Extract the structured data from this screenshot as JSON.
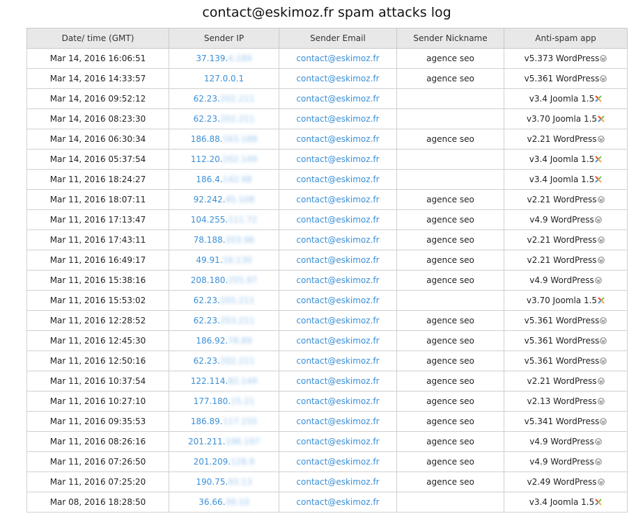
{
  "title": "contact@eskimoz.fr spam attacks log",
  "columns": [
    "Date/ time (GMT)",
    "Sender IP",
    "Sender Email",
    "Sender Nickname",
    "Anti-spam app"
  ],
  "rows": [
    {
      "date": "Mar 14, 2016 16:06:51",
      "ip": "37.139.",
      "ip_hidden": "4.189",
      "email": "contact@eskimoz.fr",
      "nick": "agence seo",
      "app": "v5.373 WordPress",
      "icon": "wordpress-icon"
    },
    {
      "date": "Mar 14, 2016 14:33:57",
      "ip": "127.0.0.1",
      "ip_hidden": "",
      "email": "contact@eskimoz.fr",
      "nick": "agence seo",
      "app": "v5.361 WordPress",
      "icon": "wordpress-icon"
    },
    {
      "date": "Mar 14, 2016 09:52:12",
      "ip": "62.23.",
      "ip_hidden": "202.211",
      "email": "contact@eskimoz.fr",
      "nick": "",
      "app": "v3.4 Joomla 1.5",
      "icon": "joomla-icon"
    },
    {
      "date": "Mar 14, 2016 08:23:30",
      "ip": "62.23.",
      "ip_hidden": "202.211",
      "email": "contact@eskimoz.fr",
      "nick": "",
      "app": "v3.70 Joomla 1.5",
      "icon": "joomla-icon"
    },
    {
      "date": "Mar 14, 2016 06:30:34",
      "ip": "186.88.",
      "ip_hidden": "163.188",
      "email": "contact@eskimoz.fr",
      "nick": "agence seo",
      "app": "v2.21 WordPress",
      "icon": "wordpress-icon"
    },
    {
      "date": "Mar 14, 2016 05:37:54",
      "ip": "112.20.",
      "ip_hidden": "202.149",
      "email": "contact@eskimoz.fr",
      "nick": "",
      "app": "v3.4 Joomla 1.5",
      "icon": "joomla-icon"
    },
    {
      "date": "Mar 11, 2016 18:24:27",
      "ip": "186.4.",
      "ip_hidden": "142.98",
      "email": "contact@eskimoz.fr",
      "nick": "",
      "app": "v3.4 Joomla 1.5",
      "icon": "joomla-icon"
    },
    {
      "date": "Mar 11, 2016 18:07:11",
      "ip": "92.242.",
      "ip_hidden": "45.108",
      "email": "contact@eskimoz.fr",
      "nick": "agence seo",
      "app": "v2.21 WordPress",
      "icon": "wordpress-icon"
    },
    {
      "date": "Mar 11, 2016 17:13:47",
      "ip": "104.255.",
      "ip_hidden": "111.72",
      "email": "contact@eskimoz.fr",
      "nick": "agence seo",
      "app": "v4.9 WordPress",
      "icon": "wordpress-icon"
    },
    {
      "date": "Mar 11, 2016 17:43:11",
      "ip": "78.188.",
      "ip_hidden": "203.96",
      "email": "contact@eskimoz.fr",
      "nick": "agence seo",
      "app": "v2.21 WordPress",
      "icon": "wordpress-icon"
    },
    {
      "date": "Mar 11, 2016 16:49:17",
      "ip": "49.91.",
      "ip_hidden": "16.130",
      "email": "contact@eskimoz.fr",
      "nick": "agence seo",
      "app": "v2.21 WordPress",
      "icon": "wordpress-icon"
    },
    {
      "date": "Mar 11, 2016 15:38:16",
      "ip": "208.180.",
      "ip_hidden": "255.97",
      "email": "contact@eskimoz.fr",
      "nick": "agence seo",
      "app": "v4.9 WordPress",
      "icon": "wordpress-icon"
    },
    {
      "date": "Mar 11, 2016 15:53:02",
      "ip": "62.23.",
      "ip_hidden": "205.211",
      "email": "contact@eskimoz.fr",
      "nick": "",
      "app": "v3.70 Joomla 1.5",
      "icon": "joomla-icon"
    },
    {
      "date": "Mar 11, 2016 12:28:52",
      "ip": "62.23.",
      "ip_hidden": "203.211",
      "email": "contact@eskimoz.fr",
      "nick": "agence seo",
      "app": "v5.361 WordPress",
      "icon": "wordpress-icon"
    },
    {
      "date": "Mar 11, 2016 12:45:30",
      "ip": "186.92.",
      "ip_hidden": "78.89",
      "email": "contact@eskimoz.fr",
      "nick": "agence seo",
      "app": "v5.361 WordPress",
      "icon": "wordpress-icon"
    },
    {
      "date": "Mar 11, 2016 12:50:16",
      "ip": "62.23.",
      "ip_hidden": "202.211",
      "email": "contact@eskimoz.fr",
      "nick": "agence seo",
      "app": "v5.361 WordPress",
      "icon": "wordpress-icon"
    },
    {
      "date": "Mar 11, 2016 10:37:54",
      "ip": "122.114.",
      "ip_hidden": "82.149",
      "email": "contact@eskimoz.fr",
      "nick": "agence seo",
      "app": "v2.21 WordPress",
      "icon": "wordpress-icon"
    },
    {
      "date": "Mar 11, 2016 10:27:10",
      "ip": "177.180.",
      "ip_hidden": "15.21",
      "email": "contact@eskimoz.fr",
      "nick": "agence seo",
      "app": "v2.13 WordPress",
      "icon": "wordpress-icon"
    },
    {
      "date": "Mar 11, 2016 09:35:53",
      "ip": "186.89.",
      "ip_hidden": "117.155",
      "email": "contact@eskimoz.fr",
      "nick": "agence seo",
      "app": "v5.341 WordPress",
      "icon": "wordpress-icon"
    },
    {
      "date": "Mar 11, 2016 08:26:16",
      "ip": "201.211.",
      "ip_hidden": "196.197",
      "email": "contact@eskimoz.fr",
      "nick": "agence seo",
      "app": "v4.9 WordPress",
      "icon": "wordpress-icon"
    },
    {
      "date": "Mar 11, 2016 07:26:50",
      "ip": "201.209.",
      "ip_hidden": "128.9",
      "email": "contact@eskimoz.fr",
      "nick": "agence seo",
      "app": "v4.9 WordPress",
      "icon": "wordpress-icon"
    },
    {
      "date": "Mar 11, 2016 07:25:20",
      "ip": "190.75.",
      "ip_hidden": "93.13",
      "email": "contact@eskimoz.fr",
      "nick": "agence seo",
      "app": "v2.49 WordPress",
      "icon": "wordpress-icon"
    },
    {
      "date": "Mar 08, 2016 18:28:50",
      "ip": "36.66.",
      "ip_hidden": "39.10",
      "email": "contact@eskimoz.fr",
      "nick": "",
      "app": "v3.4 Joomla 1.5",
      "icon": "joomla-icon"
    }
  ]
}
